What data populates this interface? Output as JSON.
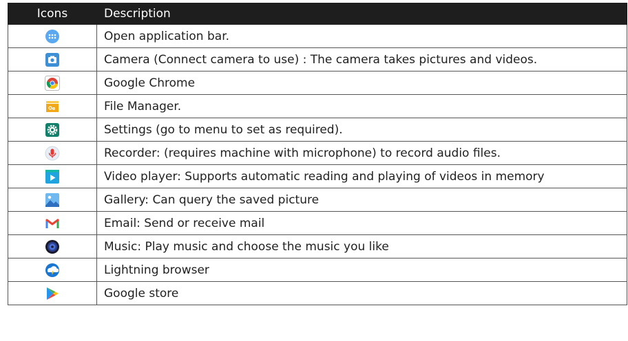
{
  "headers": {
    "icons": "Icons",
    "description": "Description"
  },
  "rows": [
    {
      "icon": "app-drawer-icon",
      "description": "Open application bar."
    },
    {
      "icon": "camera-icon",
      "description": "Camera (Connect camera to use) : The camera takes pictures and videos."
    },
    {
      "icon": "chrome-icon",
      "description": "Google Chrome"
    },
    {
      "icon": "file-manager-icon",
      "description": "File Manager."
    },
    {
      "icon": "settings-icon",
      "description": "Settings (go to menu to set as required)."
    },
    {
      "icon": "recorder-icon",
      "description": "Recorder: (requires machine with microphone) to record audio files."
    },
    {
      "icon": "video-player-icon",
      "description": "Video player: Supports automatic reading and playing of videos in memory"
    },
    {
      "icon": "gallery-icon",
      "description": "Gallery: Can query the saved picture"
    },
    {
      "icon": "gmail-icon",
      "description": "Email: Send or receive mail"
    },
    {
      "icon": "music-icon",
      "description": "Music: Play music and choose the music you like"
    },
    {
      "icon": "lightning-browser-icon",
      "description": "Lightning browser"
    },
    {
      "icon": "google-play-icon",
      "description": "Google store"
    }
  ],
  "colors": {
    "header_bg": "#1e1e1e",
    "header_text": "#ffffff",
    "border": "#555555"
  }
}
